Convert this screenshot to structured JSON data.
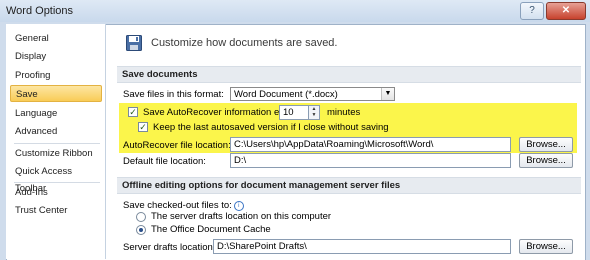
{
  "window": {
    "title": "Word Options",
    "help": "?",
    "close": "✕"
  },
  "nav": {
    "items": [
      {
        "label": "General",
        "selected": false
      },
      {
        "label": "Display",
        "selected": false
      },
      {
        "label": "Proofing",
        "selected": false
      },
      {
        "label": "Save",
        "selected": true
      },
      {
        "label": "Language",
        "selected": false
      },
      {
        "label": "Advanced",
        "selected": false
      },
      {
        "label": "Customize Ribbon",
        "selected": false
      },
      {
        "label": "Quick Access Toolbar",
        "selected": false
      },
      {
        "label": "Add-Ins",
        "selected": false
      },
      {
        "label": "Trust Center",
        "selected": false
      }
    ]
  },
  "header": {
    "text": "Customize how documents are saved."
  },
  "save_documents": {
    "section_title": "Save documents",
    "format_label": "Save files in this format:",
    "format_value": "Word Document (*.docx)",
    "autorecover_label": "Save AutoRecover information every",
    "autorecover_checked": true,
    "autorecover_minutes": "10",
    "minutes_label": "minutes",
    "keep_last_label": "Keep the last autosaved version if I close without saving",
    "keep_last_checked": true,
    "autorecover_location_label": "AutoRecover file location:",
    "autorecover_location_value": "C:\\Users\\hp\\AppData\\Roaming\\Microsoft\\Word\\",
    "browse1": "Browse...",
    "default_location_label": "Default file location:",
    "default_location_value": "D:\\",
    "browse2": "Browse..."
  },
  "offline": {
    "section_title": "Offline editing options for document management server files",
    "checked_out_label": "Save checked-out files to:",
    "option_server": "The server drafts location on this computer",
    "option_cache": "The Office Document Cache",
    "selected_option": "cache",
    "drafts_label": "Server drafts location:",
    "drafts_value": "D:\\SharePoint Drafts\\",
    "browse3": "Browse..."
  },
  "colors": {
    "highlight": "#fbf54b",
    "selected_nav": "#f9cc57"
  }
}
